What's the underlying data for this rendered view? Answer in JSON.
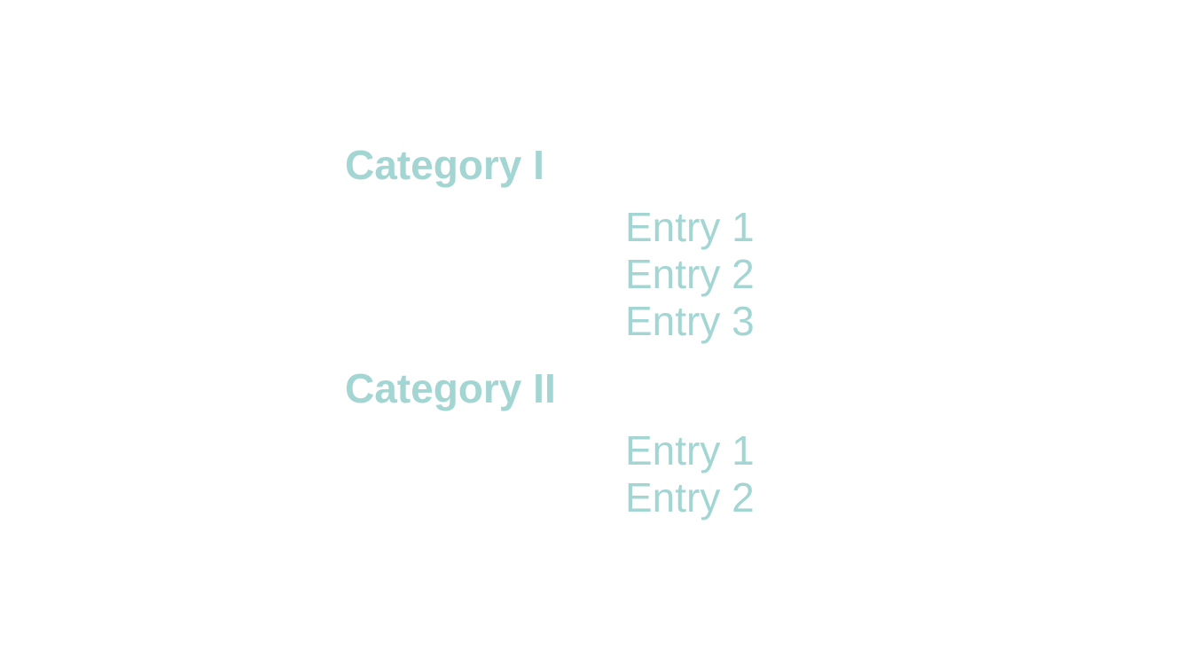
{
  "theme": {
    "text_color": "#a3d6d3",
    "background": "#ffffff"
  },
  "categories": [
    {
      "title": "Category I",
      "entries": [
        "Entry 1",
        "Entry 2",
        "Entry 3"
      ]
    },
    {
      "title": "Category II",
      "entries": [
        "Entry 1",
        "Entry 2"
      ]
    }
  ]
}
